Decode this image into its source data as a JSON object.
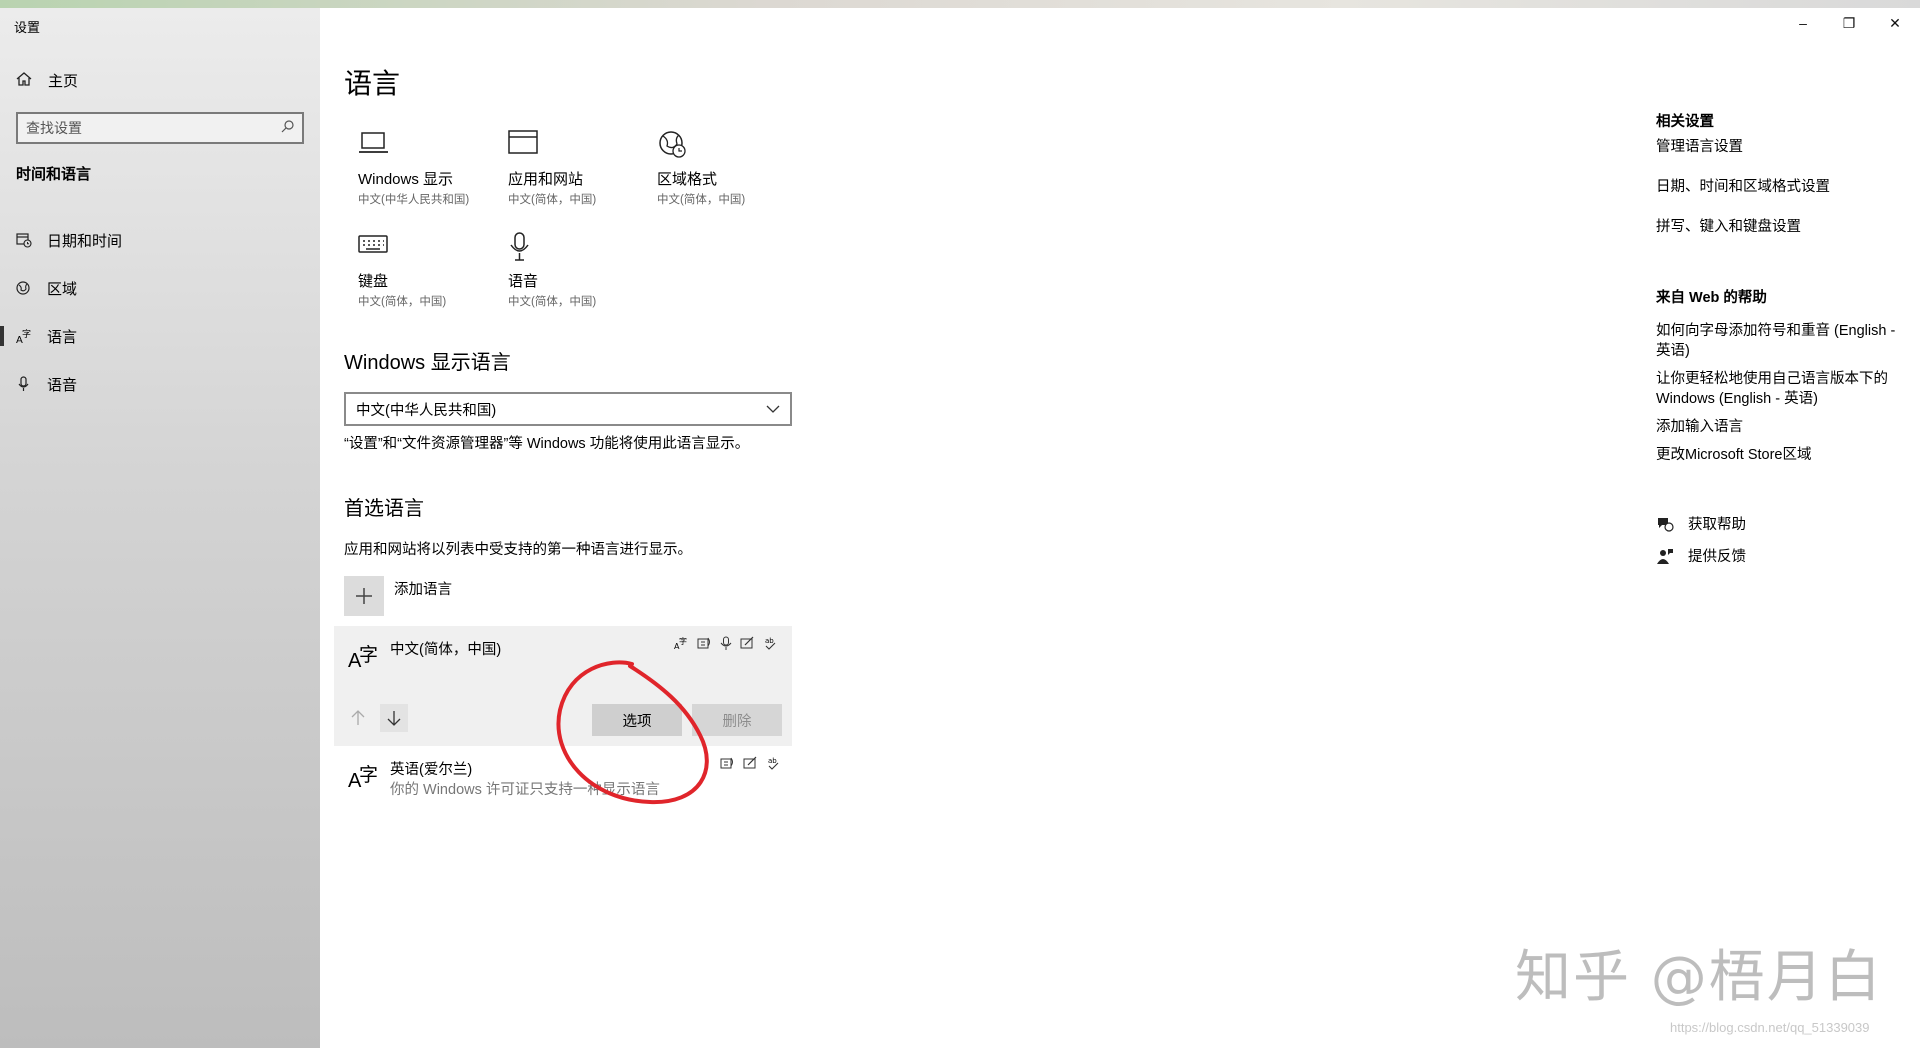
{
  "window": {
    "title": "设置",
    "minimize": "–",
    "restore": "❐",
    "close": "✕"
  },
  "sidebar": {
    "home": "主页",
    "search_placeholder": "查找设置",
    "section": "时间和语言",
    "items": [
      {
        "label": "日期和时间",
        "icon": "calendar-clock-icon"
      },
      {
        "label": "区域",
        "icon": "globe-icon"
      },
      {
        "label": "语言",
        "icon": "language-icon",
        "active": true
      },
      {
        "label": "语音",
        "icon": "microphone-icon"
      }
    ]
  },
  "main": {
    "title": "语言",
    "tiles": [
      {
        "name": "Windows 显示",
        "sub": "中文(中华人民共和国)",
        "icon": "laptop-icon"
      },
      {
        "name": "应用和网站",
        "sub": "中文(简体，中国)",
        "icon": "window-icon"
      },
      {
        "name": "区域格式",
        "sub": "中文(简体，中国)",
        "icon": "region-format-icon"
      },
      {
        "name": "键盘",
        "sub": "中文(简体，中国)",
        "icon": "keyboard-icon"
      },
      {
        "name": "语音",
        "sub": "中文(简体，中国)",
        "icon": "microphone-icon"
      }
    ],
    "display_language": {
      "heading": "Windows 显示语言",
      "selected": "中文(中华人民共和国)",
      "note": "“设置”和“文件资源管理器”等 Windows 功能将使用此语言显示。"
    },
    "preferred": {
      "heading": "首选语言",
      "note": "应用和网站将以列表中受支持的第一种语言进行显示。",
      "add_label": "添加语言",
      "languages": [
        {
          "name": "中文(简体，中国)",
          "sub": ""
        },
        {
          "name": "英语(爱尔兰)",
          "sub": "你的 Windows 许可证只支持一种显示语言"
        }
      ],
      "options_button": "选项",
      "remove_button": "删除"
    }
  },
  "right": {
    "related_heading": "相关设置",
    "related_links": [
      "管理语言设置",
      "日期、时间和区域格式设置",
      "拼写、键入和键盘设置"
    ],
    "web_heading": "来自 Web 的帮助",
    "web_links": [
      "如何向字母添加符号和重音 (English - 英语)",
      "让你更轻松地使用自己语言版本下的 Windows (English - 英语)",
      "添加输入语言",
      "更改Microsoft Store区域"
    ],
    "get_help": "获取帮助",
    "feedback": "提供反馈"
  },
  "watermark": {
    "text": "知乎 @梧月白",
    "url": "https://blog.csdn.net/qq_51339039"
  },
  "colors": {
    "annotation": "#e0252b",
    "sidebar_top": "#ececec",
    "sidebar_bottom": "#bdbdbd"
  }
}
